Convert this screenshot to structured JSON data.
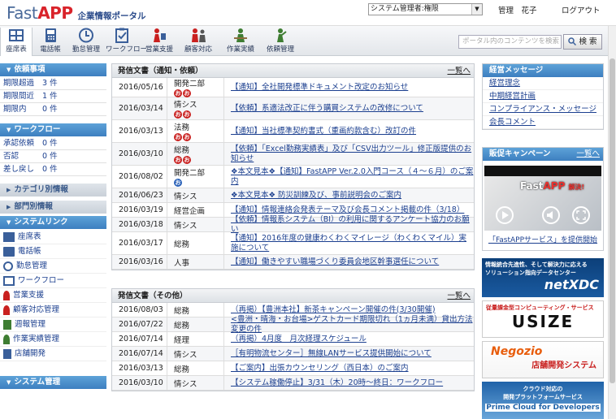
{
  "header": {
    "logo_fast": "Fast",
    "logo_app": "APP",
    "logo_sub": "企業情報ポータル",
    "role_select_value": "システム管理者:権限",
    "user_name": "管理　花子",
    "logout": "ログアウト"
  },
  "toolbar": {
    "items": [
      {
        "label": "座席表",
        "icon": "seat-chart-icon"
      },
      {
        "label": "電話帳",
        "icon": "phonebook-icon"
      },
      {
        "label": "勤怠管理",
        "icon": "clock-icon"
      },
      {
        "label": "ワークフロー",
        "icon": "clipboard-icon"
      },
      {
        "label": "営業支援",
        "icon": "sales-icon"
      },
      {
        "label": "顧客対応",
        "icon": "customer-icon"
      },
      {
        "label": "作業実績",
        "icon": "worker-icon"
      },
      {
        "label": "依頼管理",
        "icon": "request-icon"
      }
    ],
    "search_placeholder": "ポータル内のコンテンツを検索",
    "search_button": "検 索"
  },
  "sidebar": {
    "sections": [
      {
        "title": "依頼事項",
        "rows": [
          {
            "label": "期限超過",
            "count": "3 件"
          },
          {
            "label": "期限間近",
            "count": "1 件"
          },
          {
            "label": "期限内",
            "count": "0 件"
          }
        ]
      },
      {
        "title": "ワークフロー",
        "rows": [
          {
            "label": "承認依頼",
            "count": "0 件"
          },
          {
            "label": "否認",
            "count": "0 件"
          },
          {
            "label": "差し戻し",
            "count": "0 件"
          }
        ]
      }
    ],
    "category": "カテゴリ別情報",
    "department": "部門別情報",
    "system_links_title": "システムリンク",
    "system_links": [
      "座席表",
      "電話帳",
      "勤怠管理",
      "ワークフロー",
      "営業支援",
      "顧客対応管理",
      "週報管理",
      "作業実績管理",
      "店舗開発"
    ],
    "system_admin": "システム管理"
  },
  "notices": {
    "title": "発信文書（通知・依頼）",
    "more": "一覧へ",
    "rows": [
      {
        "date": "2016/05/16",
        "dept": "開発二部",
        "badges": [
          "red",
          "red"
        ],
        "title": "【通知】全社開発標準ドキュメント改定のお知らせ"
      },
      {
        "date": "2016/03/14",
        "dept": "情シス",
        "badges": [
          "red",
          "red"
        ],
        "title": "【依頼】系適法改正に伴う購買システムの改修について"
      },
      {
        "date": "2016/03/13",
        "dept": "法務",
        "badges": [
          "red",
          "red"
        ],
        "title": "【通知】当社標準契約書式（重画約款含む）改訂の件"
      },
      {
        "date": "2016/03/10",
        "dept": "総務",
        "badges": [
          "red",
          "red"
        ],
        "title": "【依頼】「Excel勤務実績表」及び「CSV出力ツール」修正版提供のお知らせ"
      },
      {
        "date": "2016/08/02",
        "dept": "開発二部",
        "badges": [
          "blue"
        ],
        "title": "❖本文見本❖【通知】FastAPP Ver.2.0入門コース（４～６月）のご案内"
      },
      {
        "date": "2016/06/23",
        "dept": "情シス",
        "badges": [],
        "title": "❖本文見本❖ 防災訓練及び、事前説明会のご案内"
      },
      {
        "date": "2016/03/19",
        "dept": "経営企画",
        "badges": [],
        "title": "【通知】情報連絡会発表テーマ及び会長コメント掲載の件（3/18）"
      },
      {
        "date": "2016/03/18",
        "dept": "情シス",
        "badges": [],
        "title": "【依頼】情報系システム（BI）の利用に関するアンケート協力のお願い"
      },
      {
        "date": "2016/03/17",
        "dept": "総務",
        "badges": [],
        "title": "【通知】2016年度の健康わくわくマイレージ（わくわくマイル）実施について"
      },
      {
        "date": "2016/03/16",
        "dept": "人事",
        "badges": [],
        "title": "【通知】働きやすい職場づくり委員会地区幹事選任について"
      }
    ]
  },
  "others": {
    "title": "発信文書（その他）",
    "more": "一覧へ",
    "rows": [
      {
        "date": "2016/08/03",
        "dept": "総務",
        "title": "（再掲）【豊洲本社】新茶キャンペーン開催の件(3/30開催)"
      },
      {
        "date": "2016/07/22",
        "dept": "総務",
        "title": "<豊洲・晴海・お台場>ゲストカード期限切れ（1ヵ月未満）貸出方法変更の件"
      },
      {
        "date": "2016/07/14",
        "dept": "経理",
        "title": "（再掲）4月度　月次経理スケジュール"
      },
      {
        "date": "2016/07/14",
        "dept": "情シス",
        "title": "［有明物流センター］無線LANサービス提供開始について"
      },
      {
        "date": "2016/03/13",
        "dept": "総務",
        "title": "【ご案内】出張カウンセリング（西日本）のご案内"
      },
      {
        "date": "2016/03/10",
        "dept": "情シス",
        "title": "【システム稼働停止】3/31（木）20時～終日：ワークフロー"
      }
    ]
  },
  "messages": {
    "title": "経営メッセージ",
    "links": [
      "経営理念",
      "中期経営計画",
      "コンプライアンス・メッセージ",
      "会長コメント"
    ]
  },
  "campaign": {
    "title": "販促キャンペーン",
    "more": "一覧へ",
    "video_title_1": "Fast",
    "video_title_2": "APP",
    "video_title_3": "解決!",
    "caption": "「FastAPPサービス」を提供開始"
  },
  "banners": [
    {
      "line1": "情報統合先進性、そして解決力に応える",
      "line2": "ソリューション指向データセンター",
      "brand": "netXDC"
    },
    {
      "line1": "従量課金型コンピューティング・サービス",
      "brand": "USIZE"
    },
    {
      "brand": "Negozio",
      "line1": "店舗開発システム"
    },
    {
      "line1": "クラウド対応の",
      "line2": "開発プラットフォームサービス",
      "brand": "Prime Cloud for Developers"
    }
  ],
  "colors": {
    "accent": "#3d7fc0",
    "logo_red": "#d9232a",
    "link": "#1b3f8f"
  }
}
